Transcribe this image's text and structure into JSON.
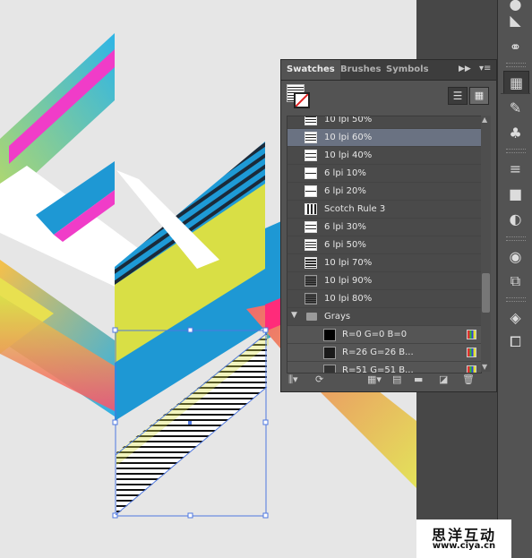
{
  "panel": {
    "tabs": [
      "Swatches",
      "Brushes",
      "Symbols"
    ],
    "swatches": [
      {
        "label": "10 lpi 50%",
        "pattern": "stripe-a"
      },
      {
        "label": "10 lpi 60%",
        "pattern": "stripe-a",
        "selected": true
      },
      {
        "label": "10 lpi 40%",
        "pattern": "stripe-b"
      },
      {
        "label": "6 lpi 10%",
        "pattern": "stripe-f"
      },
      {
        "label": "6 lpi 20%",
        "pattern": "stripe-f"
      },
      {
        "label": "Scotch Rule 3",
        "pattern": "stripe-e"
      },
      {
        "label": "6 lpi 30%",
        "pattern": "stripe-b"
      },
      {
        "label": "6 lpi 50%",
        "pattern": "stripe-a"
      },
      {
        "label": "10 lpi 70%",
        "pattern": "stripe-c"
      },
      {
        "label": "10 lpi 90%",
        "pattern": "stripe-d"
      },
      {
        "label": "10 lpi 80%",
        "pattern": "stripe-d"
      }
    ],
    "group_label": "Grays",
    "grays": [
      {
        "label": "R=0 G=0 B=0",
        "color": "#000000"
      },
      {
        "label": "R=26 G=26 B...",
        "color": "#1a1a1a"
      },
      {
        "label": "R=51 G=51 B...",
        "color": "#333333"
      }
    ]
  },
  "watermark": {
    "title": "思洋互动",
    "url": "www.ciya.cn"
  },
  "icons": {
    "toolbar": [
      "color-guide-icon",
      "link-icon",
      "swatches-icon",
      "brush-icon",
      "symbol-icon",
      "stroke-icon",
      "gradient-icon",
      "transparency-icon",
      "appearance-icon",
      "graphic-styles-icon",
      "layers-icon",
      "artboards-icon"
    ]
  }
}
